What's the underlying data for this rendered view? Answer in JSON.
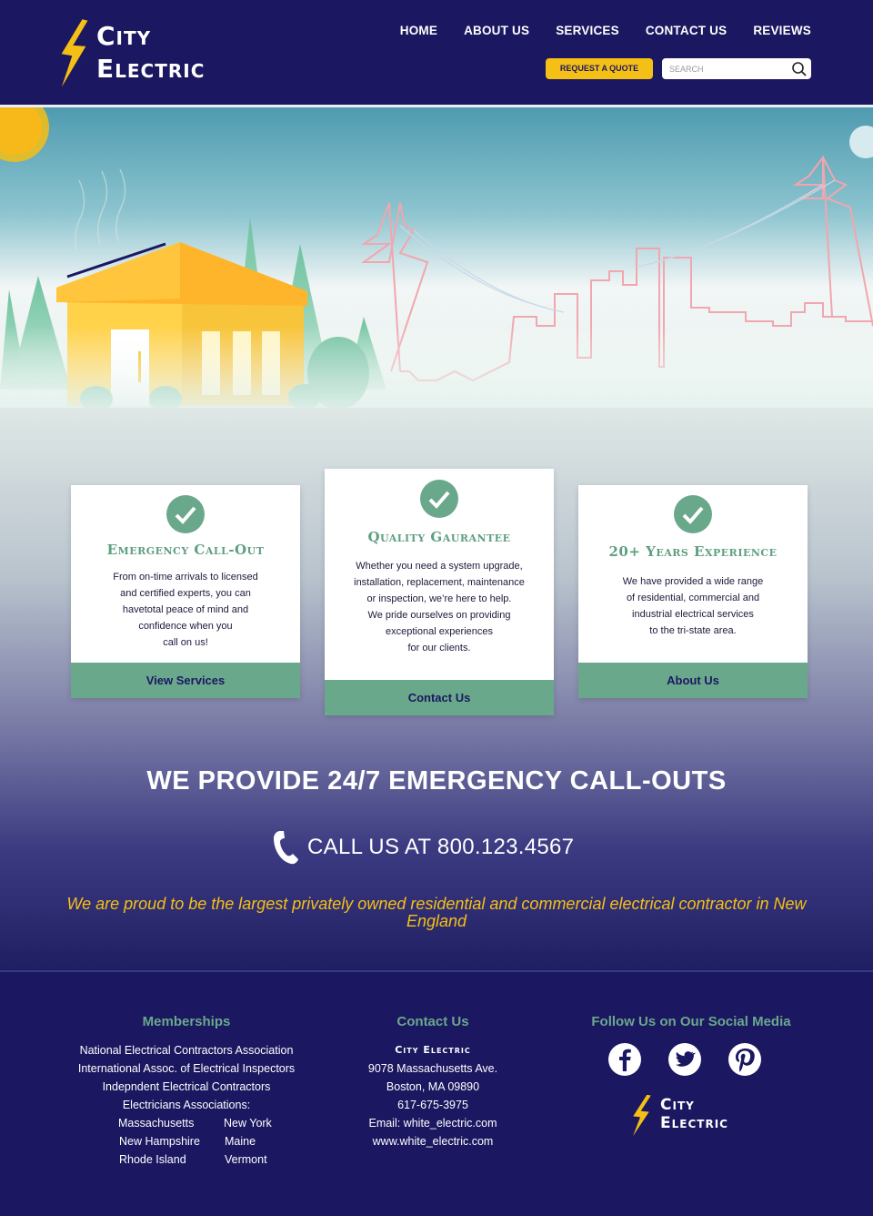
{
  "brand": {
    "line1": "City",
    "line2": "Electric"
  },
  "nav": [
    "HOME",
    "ABOUT US",
    "SERVICES",
    "CONTACT US",
    "REVIEWS"
  ],
  "header": {
    "quote_label": "REQUEST A QUOTE",
    "search_placeholder": "SEARCH"
  },
  "cards": [
    {
      "title": "Emergency Call-Out",
      "text": [
        "From on-time arrivals to licensed",
        "and certified experts, you can",
        "havetotal peace of mind and",
        "confidence when you",
        "call on us!"
      ],
      "button": "View Services"
    },
    {
      "title": "Quality Gaurantee",
      "text": [
        "Whether you need a system upgrade,",
        "installation, replacement, maintenance",
        "or inspection, we’re here to help.",
        "We pride ourselves on providing",
        "exceptional experiences",
        "for our clients."
      ],
      "button": "Contact Us"
    },
    {
      "title": "20+ Years Experience",
      "text": [
        "We have provided a wide range",
        "of residential, commercial and",
        "industrial electrical services",
        "to the tri-state area."
      ],
      "button": "About Us"
    }
  ],
  "emergency": {
    "title": "WE PROVIDE 24/7 EMERGENCY CALL-OUTS",
    "call": "CALL US AT 800.123.4567",
    "tagline": "We are proud to be the largest privately owned residential and commercial electrical contractor in New England"
  },
  "footer": {
    "memberships": {
      "title": "Memberships",
      "items": [
        "National Electrical Contractors Association",
        "International Assoc. of Electrical Inspectors",
        "Indepndent Electrical Contractors",
        "Electricians Associations:"
      ],
      "states": [
        "Massachusetts",
        "New York",
        "New Hampshire",
        "Maine",
        "Rhode Island",
        "Vermont"
      ]
    },
    "contact": {
      "title": "Contact Us",
      "brand": "City Electric",
      "lines": [
        "9078 Massachusetts Ave.",
        "Boston, MA 09890",
        "617-675-3975",
        "Email: white_electric.com",
        "www.white_electric.com"
      ]
    },
    "social": {
      "title": "Follow Us on Our Social Media",
      "icons": [
        "facebook-icon",
        "twitter-icon",
        "pinterest-icon"
      ]
    },
    "logo": {
      "line1": "City",
      "line2": "Electric"
    }
  },
  "colors": {
    "navy": "#1b1760",
    "yellow": "#f5c015",
    "green": "#6aa88c",
    "card_title": "#5e9f80"
  }
}
